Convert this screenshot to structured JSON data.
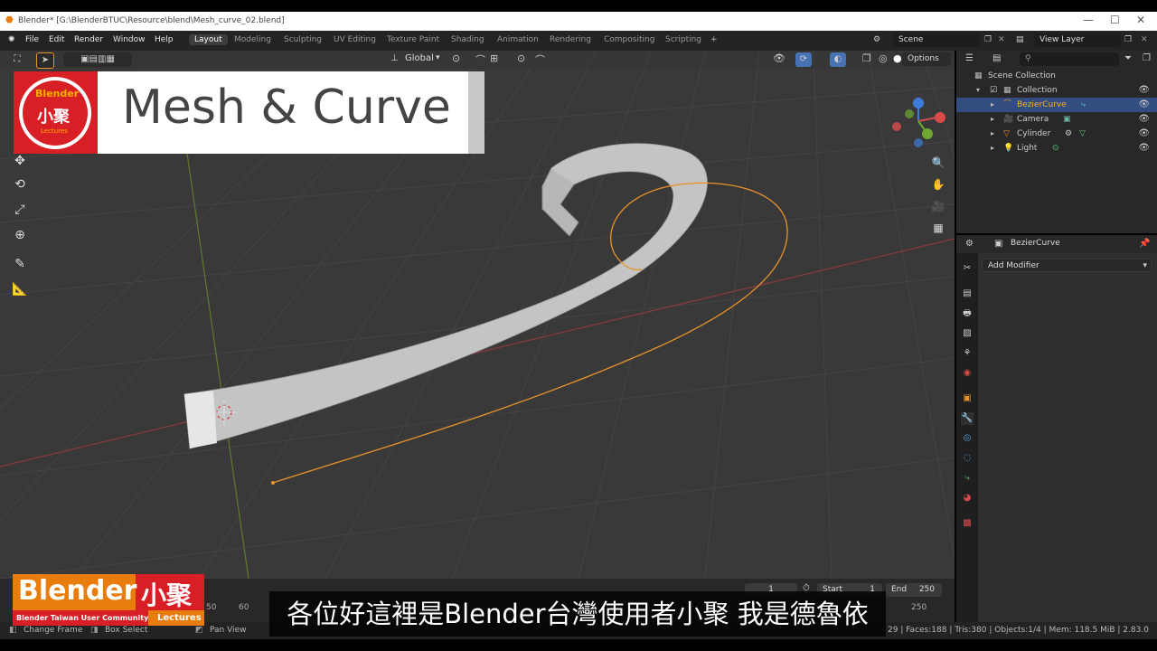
{
  "window": {
    "title": "Blender* [G:\\BlenderBTUC\\Resource\\blend\\Mesh_curve_02.blend]",
    "controls": [
      "—",
      "☐",
      "✕"
    ]
  },
  "menubar": {
    "items": [
      "File",
      "Edit",
      "Render",
      "Window",
      "Help"
    ],
    "workspaces": [
      "Layout",
      "Modeling",
      "Sculpting",
      "UV Editing",
      "Texture Paint",
      "Shading",
      "Animation",
      "Rendering",
      "Compositing",
      "Scripting"
    ],
    "add_workspace": "+",
    "scene": "Scene",
    "view_layer": "View Layer"
  },
  "viewport_header": {
    "orientation": "Global",
    "options": "Options"
  },
  "banner": {
    "title": "Mesh & Curve",
    "logo_word": "Blender",
    "logo_cjk": "小聚",
    "logo_sub": "Lectures"
  },
  "outliner": {
    "root": "Scene Collection",
    "collection": "Collection",
    "items": [
      {
        "name": "BezierCurve",
        "selected": true
      },
      {
        "name": "Camera",
        "selected": false
      },
      {
        "name": "Cylinder",
        "selected": false
      },
      {
        "name": "Light",
        "selected": false
      }
    ],
    "search_placeholder": ""
  },
  "properties": {
    "object_name": "BezierCurve",
    "add_modifier": "Add Modifier"
  },
  "timeline": {
    "current_frame": "1",
    "start_label": "Start",
    "start_value": "1",
    "end_label": "End",
    "end_value": "250",
    "ticks": [
      "50",
      "60",
      "250"
    ]
  },
  "statusbar": {
    "left1": "Change Frame",
    "left2": "Box Select",
    "left3": "Pan View",
    "stats": "29 | Faces:188 | Tris:380 | Objects:1/4 | Mem: 118.5 MiB | 2.83.0"
  },
  "lower_logo": {
    "word": "Blender",
    "cjk": "小聚",
    "community": "Blender Taiwan User Community",
    "lectures": "Lectures"
  },
  "subtitle": "各位好這裡是Blender台灣使用者小聚 我是德魯依",
  "colors": {
    "accent": "#e87d0d",
    "selection": "#334d80",
    "brand_red": "#d81f26"
  }
}
